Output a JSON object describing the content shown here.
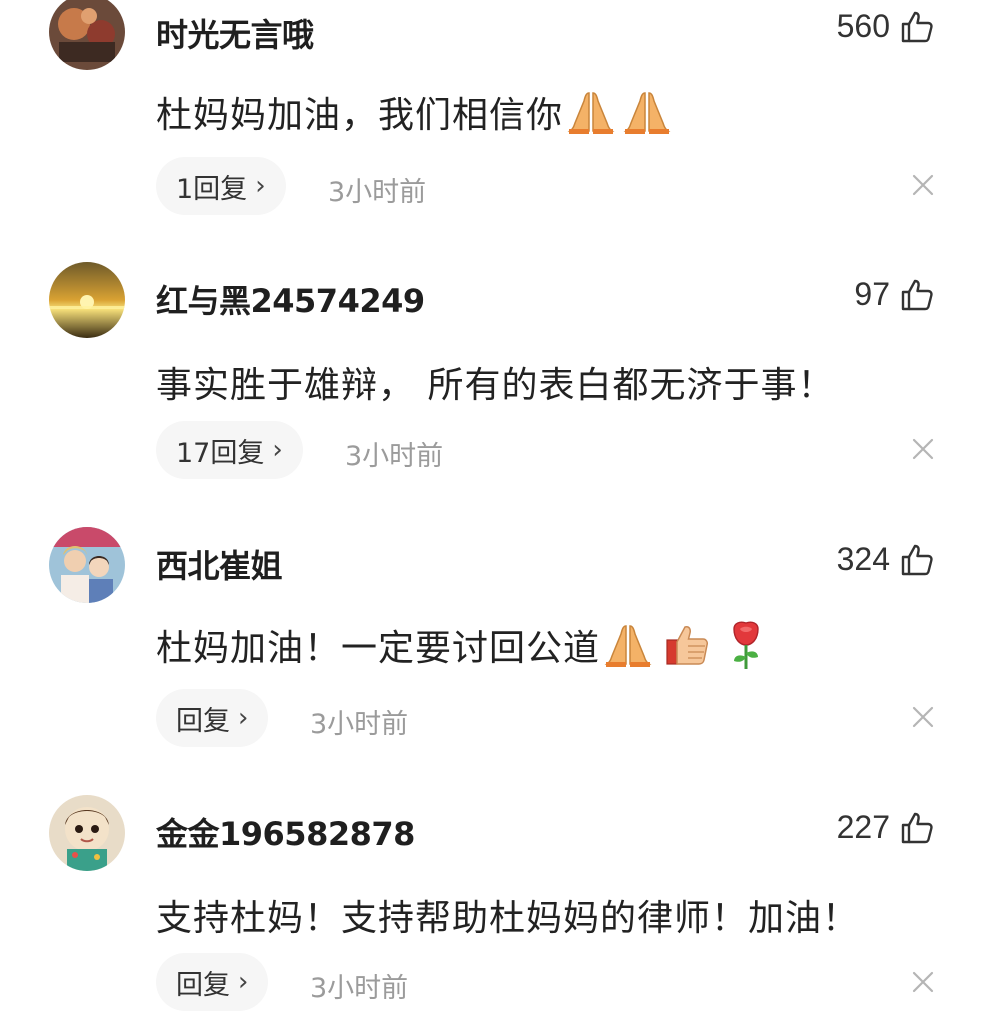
{
  "comments": [
    {
      "username": "时光无言哦",
      "likes": "560",
      "text": "杜妈妈加油，我们相信你",
      "emojis": [
        "folded-hands-icon",
        "folded-hands-icon"
      ],
      "reply_label": "1回复",
      "time": "3小时前"
    },
    {
      "username": "红与黑24574249",
      "likes": "97",
      "text": "事实胜于雄辩， 所有的表白都无济于事！",
      "emojis": [],
      "reply_label": "17回复",
      "time": "3小时前"
    },
    {
      "username": "西北崔姐",
      "likes": "324",
      "text": "杜妈加油！一定要讨回公道",
      "emojis": [
        "folded-hands-icon",
        "thumbs-up-icon",
        "rose-icon"
      ],
      "reply_label": "回复",
      "time": "3小时前"
    },
    {
      "username": "金金196582878",
      "likes": "227",
      "text": "支持杜妈！支持帮助杜妈妈的律师！加油！",
      "emojis": [],
      "reply_label": "回复",
      "time": "3小时前"
    }
  ],
  "icons": {
    "reply_chevron": "›",
    "like": "thumbs-up-outline-icon",
    "dismiss": "close-icon"
  }
}
